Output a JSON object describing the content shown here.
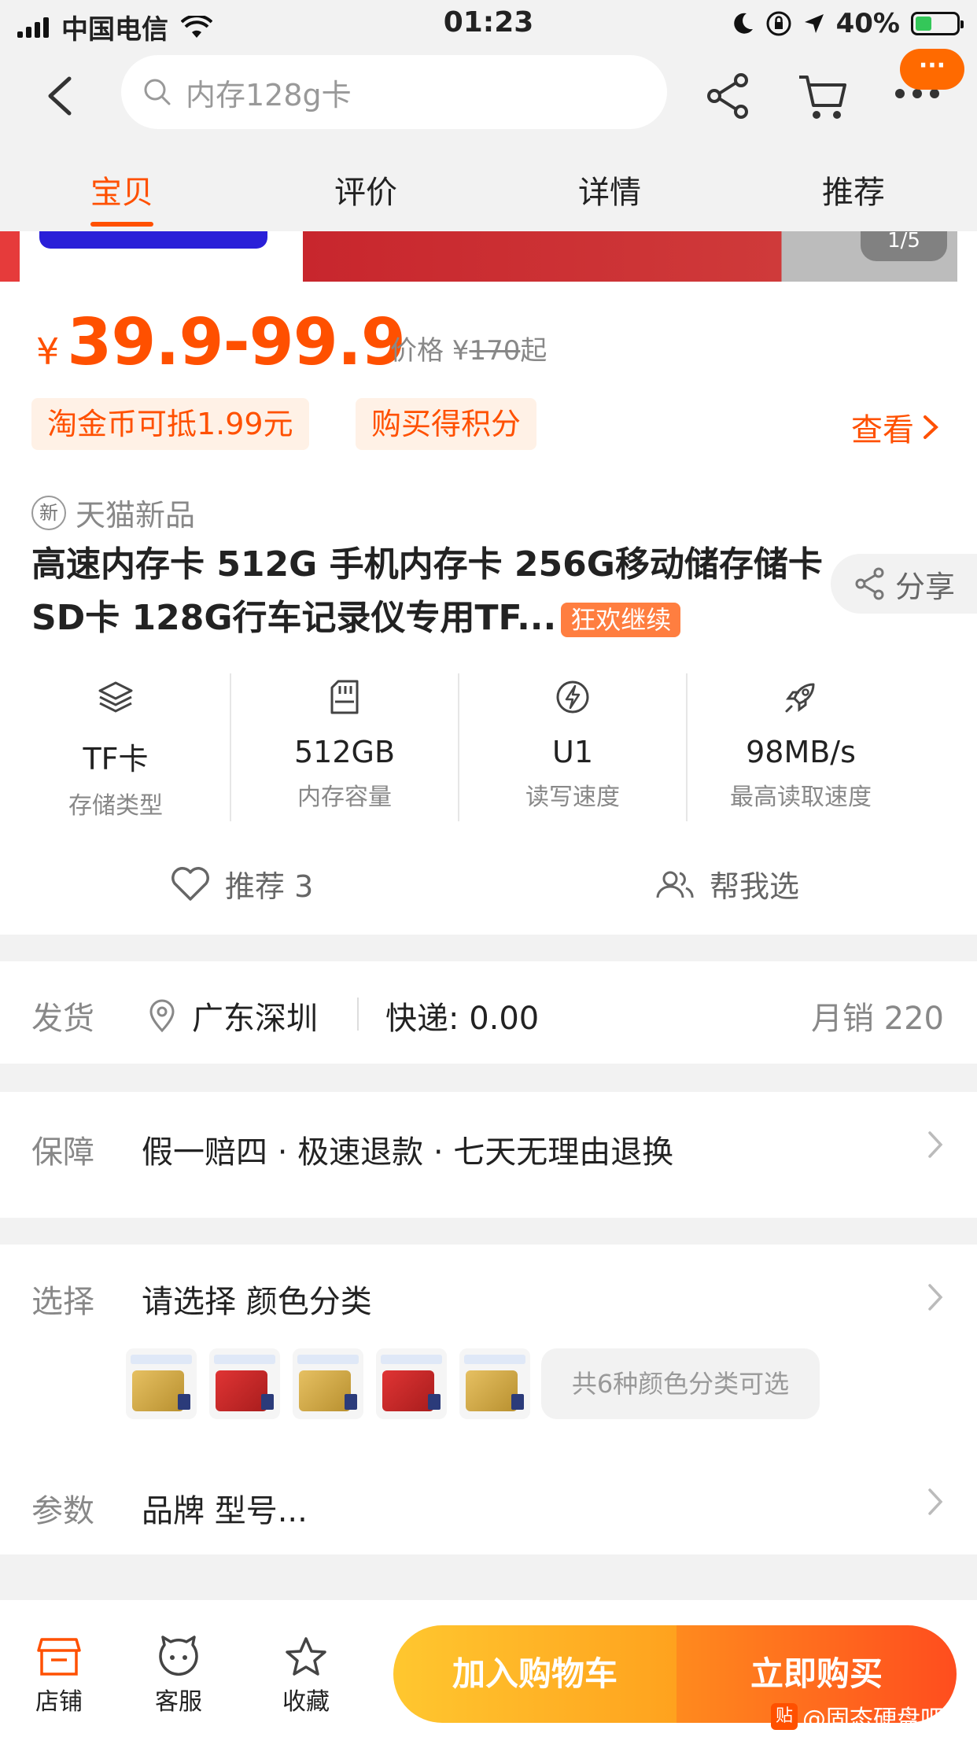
{
  "status": {
    "carrier": "中国电信",
    "time": "01:23",
    "battery": "40%",
    "battery_level": 0.4
  },
  "search": {
    "placeholder": "内存128g卡"
  },
  "badge": {
    "text": "···"
  },
  "tabs": [
    {
      "label": "宝贝",
      "active": true
    },
    {
      "label": "评价",
      "active": false
    },
    {
      "label": "详情",
      "active": false
    },
    {
      "label": "推荐",
      "active": false
    }
  ],
  "banner": {
    "counter": "1/5"
  },
  "price": {
    "currency": "¥",
    "range": "39.9-99.9",
    "orig_prefix": "价格 ¥",
    "orig_value": "170",
    "orig_suffix": "起"
  },
  "coupons": {
    "coin": "淘金币可抵1.99元",
    "points": "购买得积分",
    "view": "查看"
  },
  "product": {
    "tag_icon": "新",
    "tag": "天猫新品",
    "title": "高速内存卡 512G 手机内存卡 256G移动储存储卡 SD卡 128G行车记录仪专用TF...",
    "promo": "狂欢继续",
    "share": "分享"
  },
  "specs": [
    {
      "icon": "layers-icon",
      "value": "TF卡",
      "label": "存储类型"
    },
    {
      "icon": "sd-card-icon",
      "value": "512GB",
      "label": "内存容量"
    },
    {
      "icon": "lightning-icon",
      "value": "U1",
      "label": "读写速度"
    },
    {
      "icon": "rocket-icon",
      "value": "98MB/s",
      "label": "最高读取速度"
    }
  ],
  "actions": {
    "recommend": "推荐 3",
    "help": "帮我选"
  },
  "shipping": {
    "label": "发货",
    "location": "广东深圳",
    "fee": "快递: 0.00",
    "sales": "月销 220"
  },
  "guarantee": {
    "label": "保障",
    "text": "假一赔四 · 极速退款 · 七天无理由退换"
  },
  "select": {
    "label": "选择",
    "text": "请选择 颜色分类",
    "more": "共6种颜色分类可选"
  },
  "params": {
    "label": "参数",
    "text": "品牌 型号..."
  },
  "bottom": {
    "shop": "店铺",
    "service": "客服",
    "favorite": "收藏",
    "add_cart": "加入购物车",
    "buy_now": "立即购买"
  },
  "watermark": {
    "icon": "贴",
    "text": "@固态硬盘吧"
  },
  "colors": {
    "accent": "#ff5000",
    "cart_button": "#ffb020",
    "buy_button": "#ff5a1e"
  }
}
